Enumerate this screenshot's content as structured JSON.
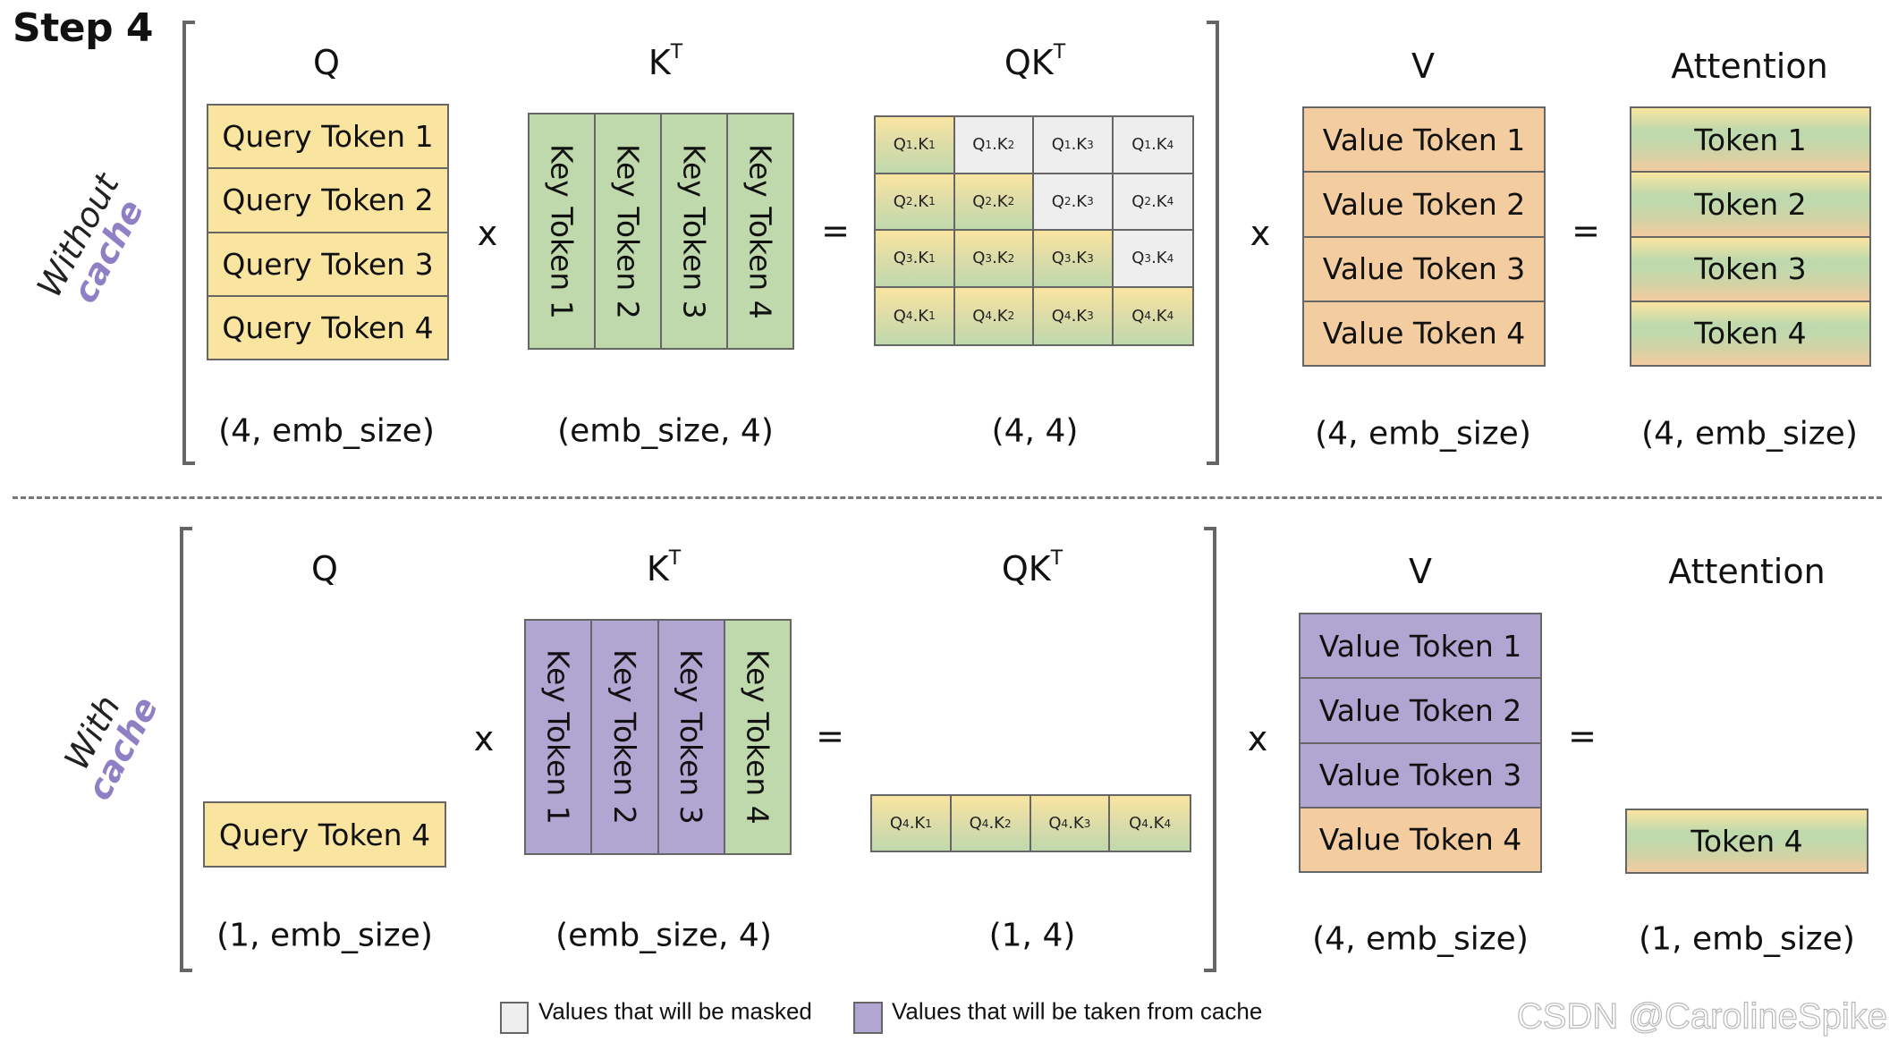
{
  "title": "Step 4",
  "colors": {
    "query": "#fae5a0",
    "key": "#c0d9ac",
    "value": "#f3cca0",
    "cache": "#b1a5d2",
    "masked": "#eeeeee",
    "cache_text": "#8f80c6",
    "border": "#666666"
  },
  "sections": {
    "without_cache": {
      "side_label": {
        "line1": "Without",
        "line2": "cache"
      },
      "q": {
        "label": "Q",
        "shape": "(4, emb_size)",
        "tokens": [
          "Query Token 1",
          "Query Token 2",
          "Query Token 3",
          "Query Token 4"
        ]
      },
      "op1": "x",
      "kt": {
        "label": "K",
        "sup": "T",
        "shape": "(emb_size, 4)",
        "tokens": [
          {
            "text": "Key Token 1",
            "source": "new"
          },
          {
            "text": "Key Token 2",
            "source": "new"
          },
          {
            "text": "Key Token 3",
            "source": "new"
          },
          {
            "text": "Key Token 4",
            "source": "new"
          }
        ]
      },
      "op2": "=",
      "qk": {
        "label": "QK",
        "sup": "T",
        "shape": "(4, 4)",
        "cells": [
          [
            {
              "q": "1",
              "k": "1",
              "masked": false
            },
            {
              "q": "1",
              "k": "2",
              "masked": true
            },
            {
              "q": "1",
              "k": "3",
              "masked": true
            },
            {
              "q": "1",
              "k": "4",
              "masked": true
            }
          ],
          [
            {
              "q": "2",
              "k": "1",
              "masked": false
            },
            {
              "q": "2",
              "k": "2",
              "masked": false
            },
            {
              "q": "2",
              "k": "3",
              "masked": true
            },
            {
              "q": "2",
              "k": "4",
              "masked": true
            }
          ],
          [
            {
              "q": "3",
              "k": "1",
              "masked": false
            },
            {
              "q": "3",
              "k": "2",
              "masked": false
            },
            {
              "q": "3",
              "k": "3",
              "masked": false
            },
            {
              "q": "3",
              "k": "4",
              "masked": true
            }
          ],
          [
            {
              "q": "4",
              "k": "1",
              "masked": false
            },
            {
              "q": "4",
              "k": "2",
              "masked": false
            },
            {
              "q": "4",
              "k": "3",
              "masked": false
            },
            {
              "q": "4",
              "k": "4",
              "masked": false
            }
          ]
        ]
      },
      "op3": "x",
      "v": {
        "label": "V",
        "shape": "(4, emb_size)",
        "tokens": [
          {
            "text": "Value Token 1",
            "source": "new"
          },
          {
            "text": "Value Token 2",
            "source": "new"
          },
          {
            "text": "Value Token 3",
            "source": "new"
          },
          {
            "text": "Value Token 4",
            "source": "new"
          }
        ]
      },
      "op4": "=",
      "attention": {
        "label": "Attention",
        "shape": "(4, emb_size)",
        "tokens": [
          "Token 1",
          "Token 2",
          "Token 3",
          "Token 4"
        ]
      }
    },
    "with_cache": {
      "side_label": {
        "line1": "With",
        "line2": "cache"
      },
      "q": {
        "label": "Q",
        "shape": "(1, emb_size)",
        "tokens": [
          "Query Token 4"
        ]
      },
      "op1": "x",
      "kt": {
        "label": "K",
        "sup": "T",
        "shape": "(emb_size, 4)",
        "tokens": [
          {
            "text": "Key Token 1",
            "source": "cache"
          },
          {
            "text": "Key Token 2",
            "source": "cache"
          },
          {
            "text": "Key Token 3",
            "source": "cache"
          },
          {
            "text": "Key Token 4",
            "source": "new"
          }
        ]
      },
      "op2": "=",
      "qk": {
        "label": "QK",
        "sup": "T",
        "shape": "(1, 4)",
        "cells": [
          [
            {
              "q": "4",
              "k": "1",
              "masked": false
            },
            {
              "q": "4",
              "k": "2",
              "masked": false
            },
            {
              "q": "4",
              "k": "3",
              "masked": false
            },
            {
              "q": "4",
              "k": "4",
              "masked": false
            }
          ]
        ]
      },
      "op3": "x",
      "v": {
        "label": "V",
        "shape": "(4, emb_size)",
        "tokens": [
          {
            "text": "Value Token 1",
            "source": "cache"
          },
          {
            "text": "Value Token 2",
            "source": "cache"
          },
          {
            "text": "Value Token 3",
            "source": "cache"
          },
          {
            "text": "Value Token 4",
            "source": "new"
          }
        ]
      },
      "op4": "=",
      "attention": {
        "label": "Attention",
        "shape": "(1, emb_size)",
        "tokens": [
          "Token 4"
        ]
      }
    }
  },
  "legend": [
    {
      "label": "Values that will be masked",
      "swatch": "masked"
    },
    {
      "label": "Values that will be taken from cache",
      "swatch": "cache"
    }
  ],
  "watermark": "CSDN @CarolineSpike"
}
